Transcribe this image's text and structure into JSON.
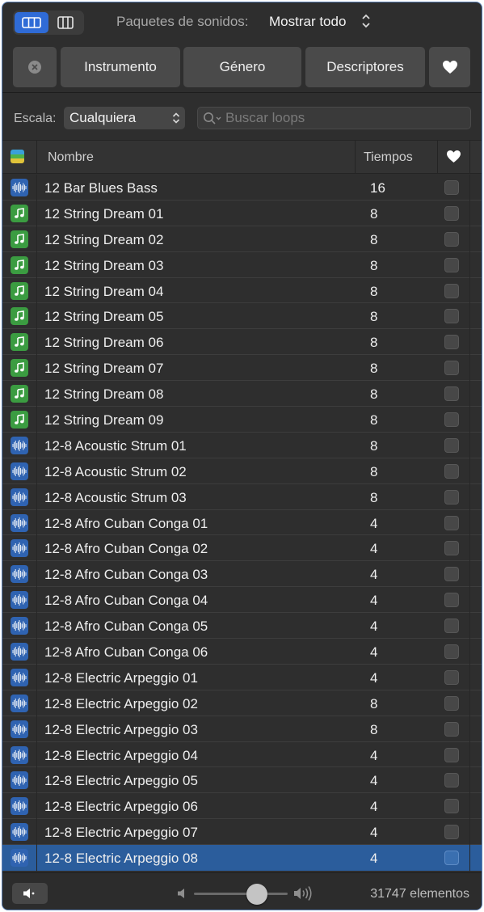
{
  "toolbar": {
    "sound_packs_label": "Paquetes de sonidos:",
    "sound_packs_value": "Mostrar todo"
  },
  "filters": {
    "instrument": "Instrumento",
    "genre": "Género",
    "descriptors": "Descriptores"
  },
  "scale": {
    "label": "Escala:",
    "value": "Cualquiera"
  },
  "search": {
    "placeholder": "Buscar loops"
  },
  "table": {
    "columns": {
      "name": "Nombre",
      "beats": "Tiempos"
    },
    "rows": [
      {
        "name": "12 Bar Blues Bass",
        "beats": "16",
        "type": "audio"
      },
      {
        "name": "12 String Dream 01",
        "beats": "8",
        "type": "midi"
      },
      {
        "name": "12 String Dream 02",
        "beats": "8",
        "type": "midi"
      },
      {
        "name": "12 String Dream 03",
        "beats": "8",
        "type": "midi"
      },
      {
        "name": "12 String Dream 04",
        "beats": "8",
        "type": "midi"
      },
      {
        "name": "12 String Dream 05",
        "beats": "8",
        "type": "midi"
      },
      {
        "name": "12 String Dream 06",
        "beats": "8",
        "type": "midi"
      },
      {
        "name": "12 String Dream 07",
        "beats": "8",
        "type": "midi"
      },
      {
        "name": "12 String Dream 08",
        "beats": "8",
        "type": "midi"
      },
      {
        "name": "12 String Dream 09",
        "beats": "8",
        "type": "midi"
      },
      {
        "name": "12-8 Acoustic Strum 01",
        "beats": "8",
        "type": "audio"
      },
      {
        "name": "12-8 Acoustic Strum 02",
        "beats": "8",
        "type": "audio"
      },
      {
        "name": "12-8 Acoustic Strum 03",
        "beats": "8",
        "type": "audio"
      },
      {
        "name": "12-8 Afro Cuban Conga 01",
        "beats": "4",
        "type": "audio"
      },
      {
        "name": "12-8 Afro Cuban Conga 02",
        "beats": "4",
        "type": "audio"
      },
      {
        "name": "12-8 Afro Cuban Conga 03",
        "beats": "4",
        "type": "audio"
      },
      {
        "name": "12-8 Afro Cuban Conga 04",
        "beats": "4",
        "type": "audio"
      },
      {
        "name": "12-8 Afro Cuban Conga 05",
        "beats": "4",
        "type": "audio"
      },
      {
        "name": "12-8 Afro Cuban Conga 06",
        "beats": "4",
        "type": "audio"
      },
      {
        "name": "12-8 Electric Arpeggio 01",
        "beats": "4",
        "type": "audio"
      },
      {
        "name": "12-8 Electric Arpeggio 02",
        "beats": "8",
        "type": "audio"
      },
      {
        "name": "12-8 Electric Arpeggio 03",
        "beats": "8",
        "type": "audio"
      },
      {
        "name": "12-8 Electric Arpeggio 04",
        "beats": "4",
        "type": "audio"
      },
      {
        "name": "12-8 Electric Arpeggio 05",
        "beats": "4",
        "type": "audio"
      },
      {
        "name": "12-8 Electric Arpeggio 06",
        "beats": "4",
        "type": "audio"
      },
      {
        "name": "12-8 Electric Arpeggio 07",
        "beats": "4",
        "type": "audio"
      },
      {
        "name": "12-8 Electric Arpeggio 08",
        "beats": "4",
        "type": "audio",
        "selected": true
      }
    ]
  },
  "footer": {
    "item_count": "31747 elementos",
    "volume_level": 0.67
  },
  "colors": {
    "accent": "#2f6bd6",
    "audio_icon": "#2f63b1",
    "midi_icon": "#3b9c41",
    "selected_row": "#2b5d9c"
  }
}
